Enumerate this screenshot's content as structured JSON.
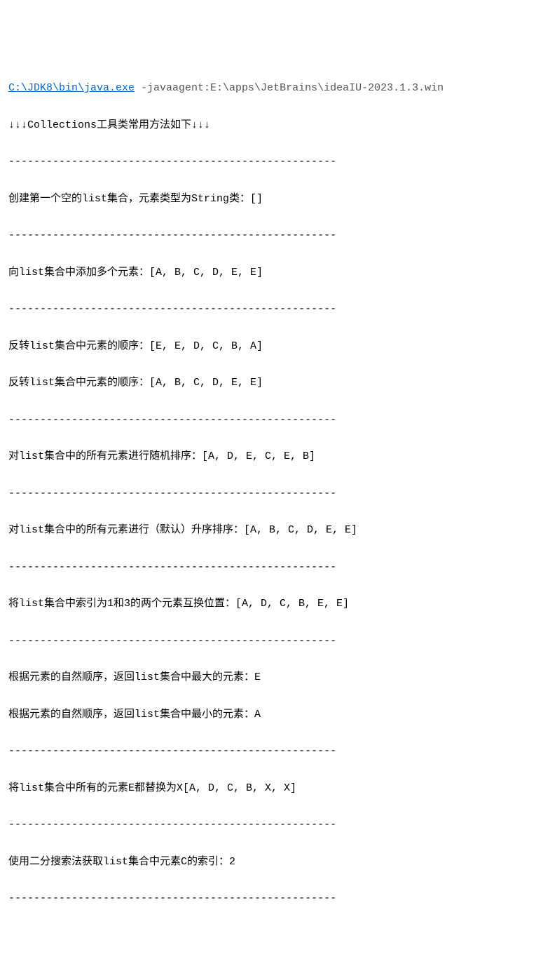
{
  "header": {
    "java_path": "C:\\JDK8\\bin\\java.exe",
    "args": " -javaagent:E:\\apps\\JetBrains\\ideaIU-2023.1.3.win"
  },
  "lines": {
    "title": "↓↓↓Collections工具类常用方法如下↓↓↓",
    "sep": "----------------------------------------------------",
    "create_empty": "创建第一个空的list集合，元素类型为String类：[]",
    "add_multi": "向list集合中添加多个元素：[A, B, C, D, E, E]",
    "reverse1": "反转list集合中元素的顺序：[E, E, D, C, B, A]",
    "reverse2": "反转list集合中元素的顺序：[A, B, C, D, E, E]",
    "shuffle": "对list集合中的所有元素进行随机排序：[A, D, E, C, E, B]",
    "sort": "对list集合中的所有元素进行（默认）升序排序：[A, B, C, D, E, E]",
    "swap": "将list集合中索引为1和3的两个元素互换位置：[A, D, C, B, E, E]",
    "max": "根据元素的自然顺序，返回list集合中最大的元素：E",
    "min": "根据元素的自然顺序，返回list集合中最小的元素：A",
    "replace": "将list集合中所有的元素E都替换为X[A, D, C, B, X, X]",
    "binsearch": "使用二分搜索法获取list集合中元素C的索引：2"
  }
}
